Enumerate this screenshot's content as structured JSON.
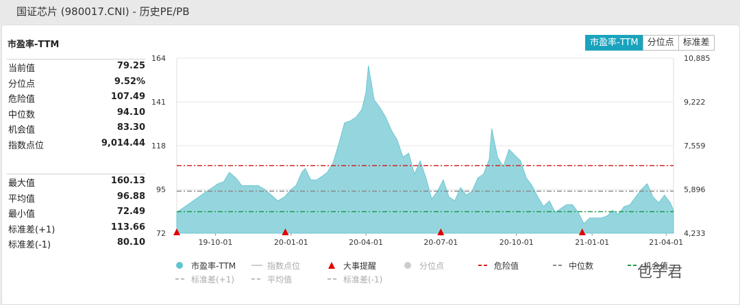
{
  "window_title": "国证芯片 (980017.CNI) - 历史PE/PB",
  "panel_title": "市盈率-TTM",
  "tabs": [
    "市盈率-TTM",
    "分位点",
    "标准差"
  ],
  "stats_top": [
    {
      "label": "当前值",
      "value": "79.25"
    },
    {
      "label": "分位点",
      "value": "9.52%"
    },
    {
      "label": "危险值",
      "value": "107.49"
    },
    {
      "label": "中位数",
      "value": "94.10"
    },
    {
      "label": "机会值",
      "value": "83.30"
    },
    {
      "label": "指数点位",
      "value": "9,014.44"
    }
  ],
  "stats_bottom": [
    {
      "label": "最大值",
      "value": "160.13"
    },
    {
      "label": "平均值",
      "value": "96.88"
    },
    {
      "label": "最小值",
      "value": "72.49"
    },
    {
      "label": "标准差(+1)",
      "value": "113.66"
    },
    {
      "label": "标准差(-1)",
      "value": "80.10"
    }
  ],
  "legend": [
    {
      "label": "市盈率-TTM",
      "color": "#5ec6d2",
      "style": "dot",
      "dim": false
    },
    {
      "label": "指数点位",
      "color": "#cccccc",
      "style": "line",
      "dim": true
    },
    {
      "label": "大事提醒",
      "color": "#e00000",
      "style": "triangle",
      "dim": false
    },
    {
      "label": "分位点",
      "color": "#cccccc",
      "style": "dot",
      "dim": true
    },
    {
      "label": "危险值",
      "color": "#d42020",
      "style": "dash",
      "dim": false
    },
    {
      "label": "中位数",
      "color": "#888888",
      "style": "dash",
      "dim": false
    },
    {
      "label": "机会值",
      "color": "#1a9a4a",
      "style": "dash",
      "dim": false
    },
    {
      "label": "标准差(+1)",
      "color": "#bbbbbb",
      "style": "dash",
      "dim": true
    },
    {
      "label": "平均值",
      "color": "#bbbbbb",
      "style": "dash",
      "dim": true
    },
    {
      "label": "标准差(-1)",
      "color": "#bbbbbb",
      "style": "dash",
      "dim": true
    }
  ],
  "watermark": "包子君",
  "chart_data": {
    "type": "area",
    "x_range": [
      "2019-08-15",
      "2021-04-10"
    ],
    "x_ticks": [
      "19-10-01",
      "20-01-01",
      "20-04-01",
      "20-07-01",
      "20-10-01",
      "21-01-01",
      "21-04-01"
    ],
    "ylim": [
      72,
      164
    ],
    "y_ticks": [
      72,
      95,
      118,
      141,
      164
    ],
    "y2_ticks": [
      "4,233",
      "5,896",
      "7,559",
      "9,222",
      "10,885"
    ],
    "series": [
      {
        "name": "市盈率-TTM",
        "color": "#5ec6d2",
        "points": [
          [
            "2019-08-15",
            83
          ],
          [
            "2019-08-25",
            86
          ],
          [
            "2019-09-04",
            89
          ],
          [
            "2019-09-14",
            92
          ],
          [
            "2019-09-24",
            95
          ],
          [
            "2019-10-04",
            98
          ],
          [
            "2019-10-11",
            99
          ],
          [
            "2019-10-18",
            104
          ],
          [
            "2019-10-26",
            101
          ],
          [
            "2019-11-02",
            97
          ],
          [
            "2019-11-12",
            97
          ],
          [
            "2019-11-22",
            97
          ],
          [
            "2019-11-30",
            95
          ],
          [
            "2019-12-08",
            92
          ],
          [
            "2019-12-16",
            89
          ],
          [
            "2019-12-24",
            91
          ],
          [
            "2020-01-01",
            95
          ],
          [
            "2020-01-07",
            97
          ],
          [
            "2020-01-14",
            104
          ],
          [
            "2020-01-18",
            106
          ],
          [
            "2020-01-25",
            100
          ],
          [
            "2020-02-01",
            100
          ],
          [
            "2020-02-08",
            102
          ],
          [
            "2020-02-14",
            104
          ],
          [
            "2020-02-21",
            109
          ],
          [
            "2020-02-28",
            119
          ],
          [
            "2020-03-06",
            130
          ],
          [
            "2020-03-13",
            131
          ],
          [
            "2020-03-20",
            133
          ],
          [
            "2020-03-27",
            137
          ],
          [
            "2020-04-01",
            146
          ],
          [
            "2020-04-04",
            160
          ],
          [
            "2020-04-11",
            142
          ],
          [
            "2020-04-18",
            138
          ],
          [
            "2020-04-25",
            133
          ],
          [
            "2020-05-02",
            126
          ],
          [
            "2020-05-09",
            121
          ],
          [
            "2020-05-16",
            112
          ],
          [
            "2020-05-23",
            114
          ],
          [
            "2020-05-30",
            103
          ],
          [
            "2020-06-06",
            110
          ],
          [
            "2020-06-13",
            101
          ],
          [
            "2020-06-20",
            90
          ],
          [
            "2020-06-27",
            94
          ],
          [
            "2020-07-04",
            100
          ],
          [
            "2020-07-11",
            91
          ],
          [
            "2020-07-18",
            89
          ],
          [
            "2020-07-25",
            96
          ],
          [
            "2020-08-01",
            92
          ],
          [
            "2020-08-08",
            94
          ],
          [
            "2020-08-15",
            101
          ],
          [
            "2020-08-22",
            103
          ],
          [
            "2020-08-29",
            111
          ],
          [
            "2020-09-01",
            127
          ],
          [
            "2020-09-08",
            112
          ],
          [
            "2020-09-15",
            107
          ],
          [
            "2020-09-22",
            116
          ],
          [
            "2020-09-29",
            113
          ],
          [
            "2020-10-06",
            110
          ],
          [
            "2020-10-13",
            101
          ],
          [
            "2020-10-20",
            97
          ],
          [
            "2020-10-27",
            91
          ],
          [
            "2020-11-03",
            86
          ],
          [
            "2020-11-10",
            89
          ],
          [
            "2020-11-17",
            83
          ],
          [
            "2020-11-24",
            85
          ],
          [
            "2020-12-01",
            87
          ],
          [
            "2020-12-08",
            87
          ],
          [
            "2020-12-15",
            83
          ],
          [
            "2020-12-22",
            77
          ],
          [
            "2020-12-29",
            80
          ],
          [
            "2021-01-05",
            80
          ],
          [
            "2021-01-12",
            80
          ],
          [
            "2021-01-19",
            81
          ],
          [
            "2021-01-26",
            84
          ],
          [
            "2021-02-02",
            82
          ],
          [
            "2021-02-09",
            86
          ],
          [
            "2021-02-16",
            87
          ],
          [
            "2021-02-23",
            91
          ],
          [
            "2021-03-02",
            95
          ],
          [
            "2021-03-09",
            98
          ],
          [
            "2021-03-16",
            91
          ],
          [
            "2021-03-23",
            88
          ],
          [
            "2021-03-30",
            92
          ],
          [
            "2021-04-06",
            88
          ],
          [
            "2021-04-10",
            84
          ]
        ]
      }
    ],
    "reference_lines": [
      {
        "name": "危险值",
        "value": 107.49,
        "color": "#d42020"
      },
      {
        "name": "中位数",
        "value": 94.1,
        "color": "#888888"
      },
      {
        "name": "机会值",
        "value": 83.3,
        "color": "#1a9a4a"
      }
    ],
    "events": [
      "2019-08-15",
      "2019-12-25",
      "2020-07-01",
      "2020-12-20"
    ]
  }
}
